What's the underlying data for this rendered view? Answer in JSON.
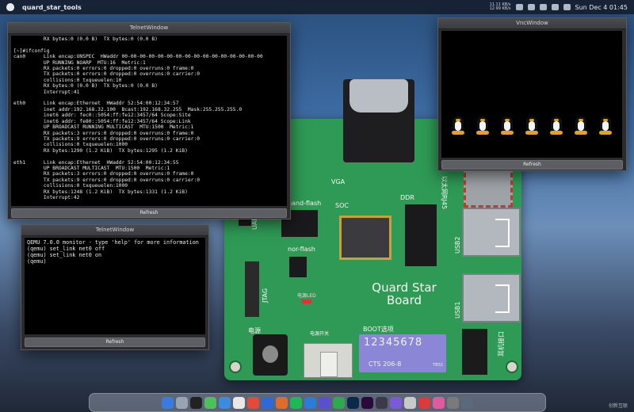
{
  "menubar": {
    "app_name": "quard_star_tools",
    "clock": "Sun Dec 4  01:45",
    "net_stat_up": "11.11 KB/s",
    "net_stat_down": "12.99 KB/s"
  },
  "board": {
    "title_line1": "Quard Star",
    "title_line2": "Board",
    "label_vga": "VGA",
    "label_eth": "eth",
    "label_eth_port": "以太网RJ45",
    "label_soc": "SOC",
    "label_ddr": "DDR",
    "label_nand": "nand-flash",
    "label_nor": "nor-flash",
    "label_uart2": "UART2",
    "label_jtag": "JTAG",
    "label_power_led": "电源LED",
    "label_power": "电源",
    "label_switch": "电源开关",
    "label_boot": "BOOT选项",
    "label_usb2": "USB2",
    "label_usb1": "USB1",
    "label_ear": "耳机接口",
    "dip_numbers": "12345678",
    "dip_model": "CTS 206-8",
    "dip_model_small": "TB32"
  },
  "telnet_top": {
    "title": "TelnetWindow",
    "refresh": "Refresh",
    "lines": "          RX bytes:0 (0.0 B)  TX bytes:0 (0.0 B)\n\n[~]#ifconfig\ncan0      Link encap:UNSPEC  HWaddr 00-00-00-00-00-00-00-00-00-00-00-00-00-00-00-00\n          UP RUNNING NOARP  MTU:16  Metric:1\n          RX packets:0 errors:0 dropped:0 overruns:0 frame:0\n          TX packets:0 errors:0 dropped:0 overruns:0 carrier:0\n          collisions:0 txqueuelen:10\n          RX bytes:0 (0.0 B)  TX bytes:0 (0.0 B)\n          Interrupt:41\n\neth0      Link encap:Ethernet  HWaddr 52:54:00:12:34:57\n          inet addr:192.168.32.100  Bcast:192.168.32.255  Mask:255.255.255.0\n          inet6 addr: fec0::5054:ff:fe12:3457/64 Scope:Site\n          inet6 addr: fe80::5054:ff:fe12:3457/64 Scope:Link\n          UP BROADCAST RUNNING MULTICAST  MTU:1500  Metric:1\n          RX packets:3 errors:0 dropped:0 overruns:0 frame:0\n          TX packets:9 errors:0 dropped:0 overruns:0 carrier:0\n          collisions:0 txqueuelen:1000\n          RX bytes:1290 (1.2 KiB)  TX bytes:1295 (1.2 KiB)\n\neth1      Link encap:Ethernet  HWaddr 52:54:00:12:34:55\n          UP BROADCAST MULTICAST  MTU:1500  Metric:1\n          RX packets:3 errors:0 dropped:0 overruns:0 frame:0\n          TX packets:9 errors:0 dropped:0 overruns:0 carrier:0\n          collisions:0 txqueuelen:1000\n          RX bytes:1248 (1.2 KiB)  TX bytes:1331 (1.2 KiB)\n          Interrupt:42"
  },
  "telnet_bottom": {
    "title": "TelnetWindow",
    "refresh": "Refresh",
    "lines": "QEMU 7.0.0 monitor - type 'help' for more information\n(qemu) set_link net0 off\n(qemu) set_link net0 on\n(qemu)"
  },
  "vnc": {
    "title": "VncWindow",
    "refresh": "Refresh",
    "tux_icon": "tux-penguin-icon"
  },
  "watermark": "创新互联"
}
